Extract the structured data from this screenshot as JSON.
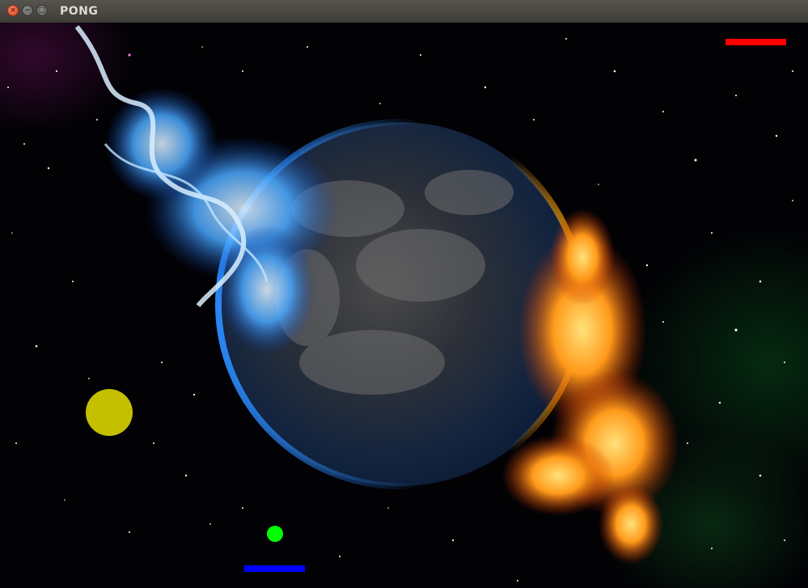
{
  "window": {
    "title": "PONG",
    "close_glyph": "×",
    "minimize_glyph": "−",
    "maximize_glyph": "□"
  },
  "game": {
    "background": "space-earth-fire-ice-image",
    "colors": {
      "top_paddle": "#ff0000",
      "bottom_paddle": "#0000ff",
      "ball": "#00ff00",
      "powerup": "#c4c000"
    }
  }
}
